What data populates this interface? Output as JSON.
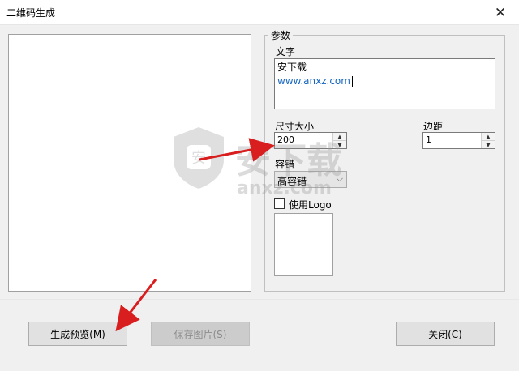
{
  "window": {
    "title": "二维码生成",
    "close_glyph": "✕"
  },
  "params": {
    "group_label": "参数",
    "text_label": "文字",
    "text_line1": "安下载",
    "text_line2": "www.anxz.com",
    "size_label": "尺寸大小",
    "size_value": "200",
    "margin_label": "边距",
    "margin_value": "1",
    "error_label": "容错",
    "error_value": "高容错",
    "use_logo_label": "使用Logo",
    "use_logo_checked": false
  },
  "buttons": {
    "generate": "生成预览(M)",
    "save": "保存图片(S)",
    "close": "关闭(C)"
  },
  "watermark": {
    "text": "安下载",
    "sub": "anxz.com"
  },
  "colors": {
    "link": "#1565c0",
    "arrow": "#d81e1e"
  },
  "icons": [
    "close-icon",
    "spin-up-icon",
    "spin-down-icon",
    "dropdown-arrow-icon",
    "shield-logo-icon",
    "red-arrow-icon"
  ]
}
